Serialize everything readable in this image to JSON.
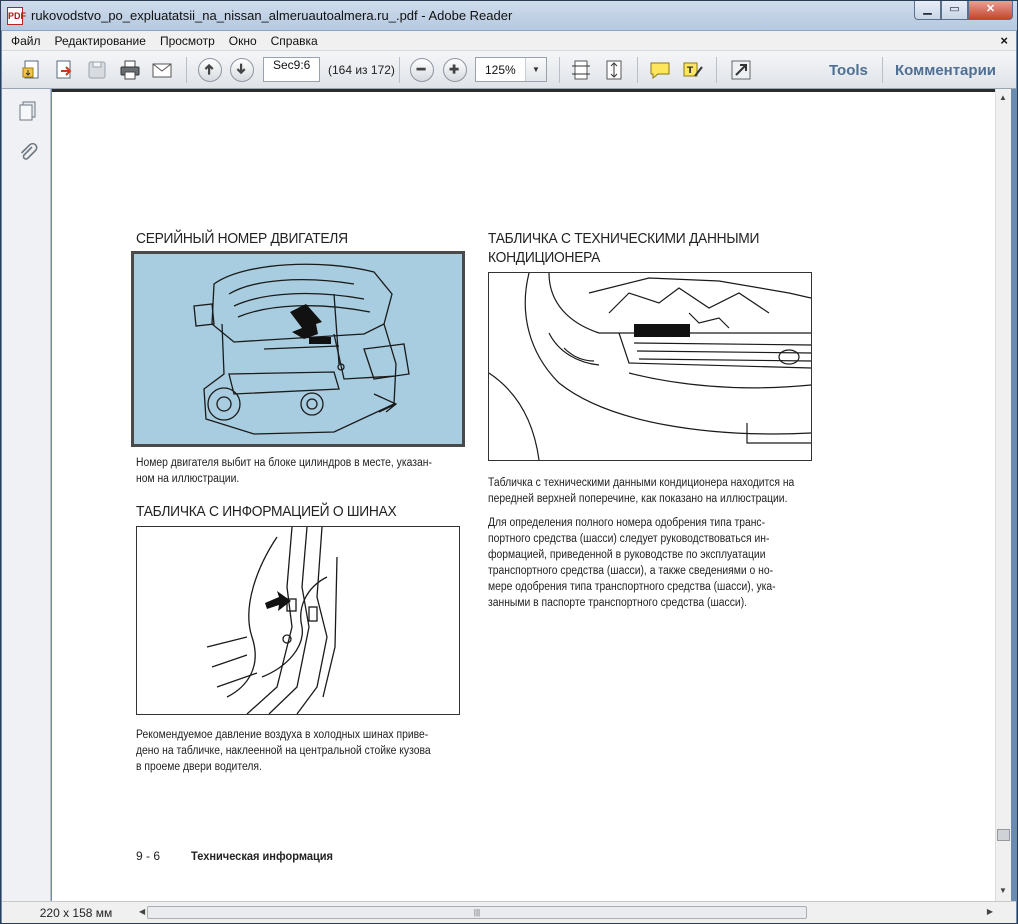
{
  "window": {
    "title": "rukovodstvo_po_expluatatsii_na_nissan_almeruautoalmera.ru_.pdf - Adobe Reader",
    "minimize": "▁",
    "maximize": "▭",
    "close": "✕"
  },
  "menu": {
    "items": [
      "Файл",
      "Редактирование",
      "Просмотр",
      "Окно",
      "Справка"
    ],
    "close_doc": "×"
  },
  "toolbar": {
    "page_input": "Sec9:6",
    "page_count": "(164 из 172)",
    "zoom": "125%",
    "tools_label": "Tools",
    "comments_label": "Комментарии"
  },
  "status": {
    "page_size": "220 x 158 мм"
  },
  "document": {
    "section_engine": {
      "heading": "СЕРИЙНЫЙ НОМЕР ДВИГАТЕЛЯ",
      "lines": [
        "Номер двигателя выбит на блоке цилиндров в месте, указан-",
        "ном на иллюстрации."
      ]
    },
    "section_tire": {
      "heading": "ТАБЛИЧКА С ИНФОРМАЦИЕЙ О ШИНАХ",
      "lines": [
        "Рекомендуемое давление воздуха в холодных шинах приве-",
        "дено на табличке, наклеенной на центральной стойке кузова",
        "в проеме двери водителя."
      ]
    },
    "section_ac": {
      "heading_lines": [
        "ТАБЛИЧКА С ТЕХНИЧЕСКИМИ ДАННЫМИ",
        "КОНДИЦИОНЕРА"
      ],
      "para1_lines": [
        "Табличка с техническими данными кондиционера находится на",
        "передней верхней поперечине, как показано на иллюстрации."
      ],
      "para2_lines": [
        "Для определения полного номера одобрения типа транс-",
        "портного средства (шасси) следует руководствоваться ин-",
        "формацией, приведенной в руководстве по эксплуатации",
        "транспортного средства (шасси), а также сведениями о но-",
        "мере одобрения типа транспортного средства (шасси), ука-",
        "занными в паспорте транспортного средства (шасси)."
      ]
    },
    "footer": {
      "page_number": "9 - 6",
      "title": "Техническая информация"
    }
  },
  "colors": {
    "engine_fig_bg": "#a9cde0",
    "link_blue": "#4f6f93"
  }
}
